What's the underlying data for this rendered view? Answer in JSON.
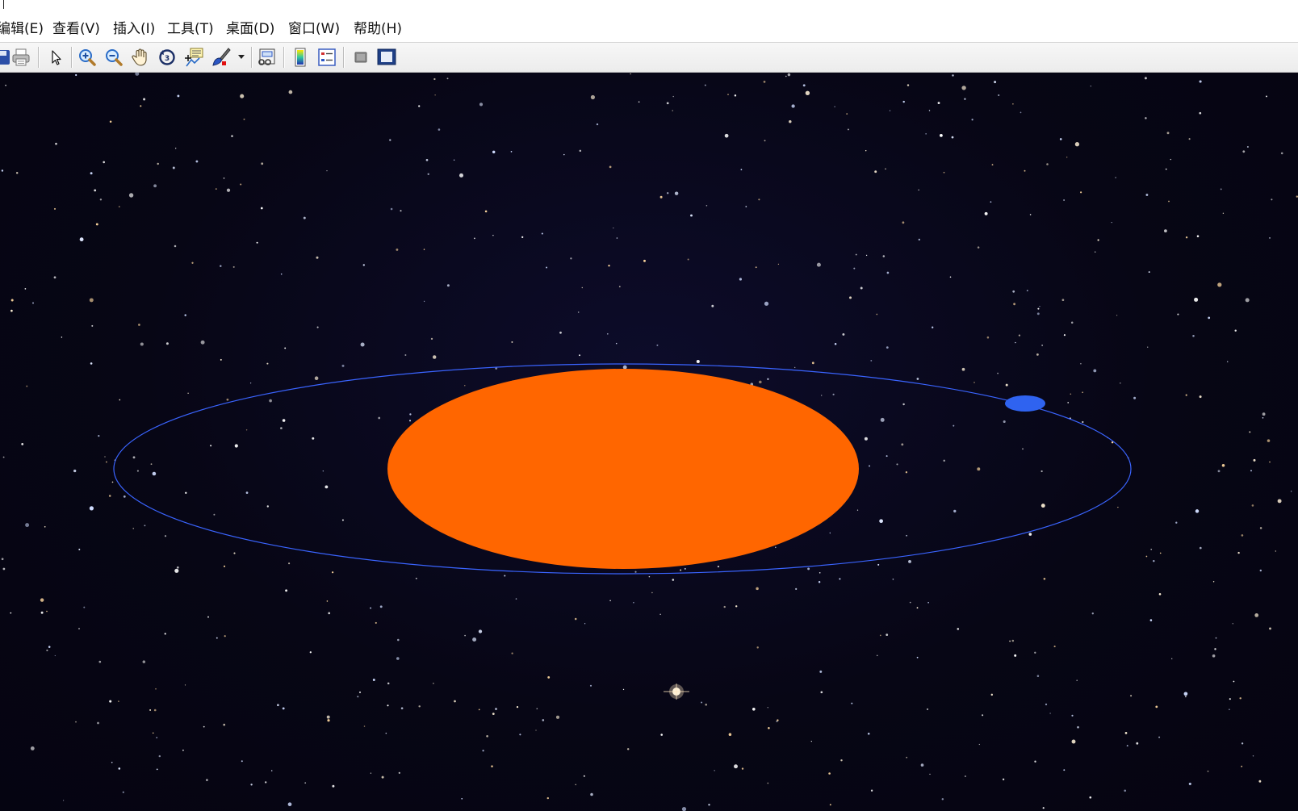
{
  "titlebar": {
    "title": ""
  },
  "menubar": {
    "items": [
      {
        "label": "编辑(E)"
      },
      {
        "label": "查看(V)"
      },
      {
        "label": "插入(I)"
      },
      {
        "label": "工具(T)"
      },
      {
        "label": "桌面(D)"
      },
      {
        "label": "窗口(W)"
      },
      {
        "label": "帮助(H)"
      }
    ]
  },
  "toolbar": {
    "buttons": [
      {
        "icon": "save-icon"
      },
      {
        "icon": "print-icon"
      },
      {
        "icon": "pointer-icon"
      },
      {
        "icon": "zoom-in-icon"
      },
      {
        "icon": "zoom-out-icon"
      },
      {
        "icon": "pan-hand-icon"
      },
      {
        "icon": "rotate-3d-icon"
      },
      {
        "icon": "data-cursor-icon"
      },
      {
        "icon": "brush-icon"
      },
      {
        "icon": "link-plot-icon"
      },
      {
        "icon": "colorbar-icon"
      },
      {
        "icon": "legend-icon"
      },
      {
        "icon": "hide-plot-tools-icon"
      },
      {
        "icon": "show-plot-tools-icon"
      }
    ]
  },
  "scene": {
    "background_color": "#07061a",
    "sun_color": "#ff6600",
    "orbit_color": "#3a64ff",
    "planet_color": "#2f63f0",
    "star_color": "#ffffff"
  }
}
